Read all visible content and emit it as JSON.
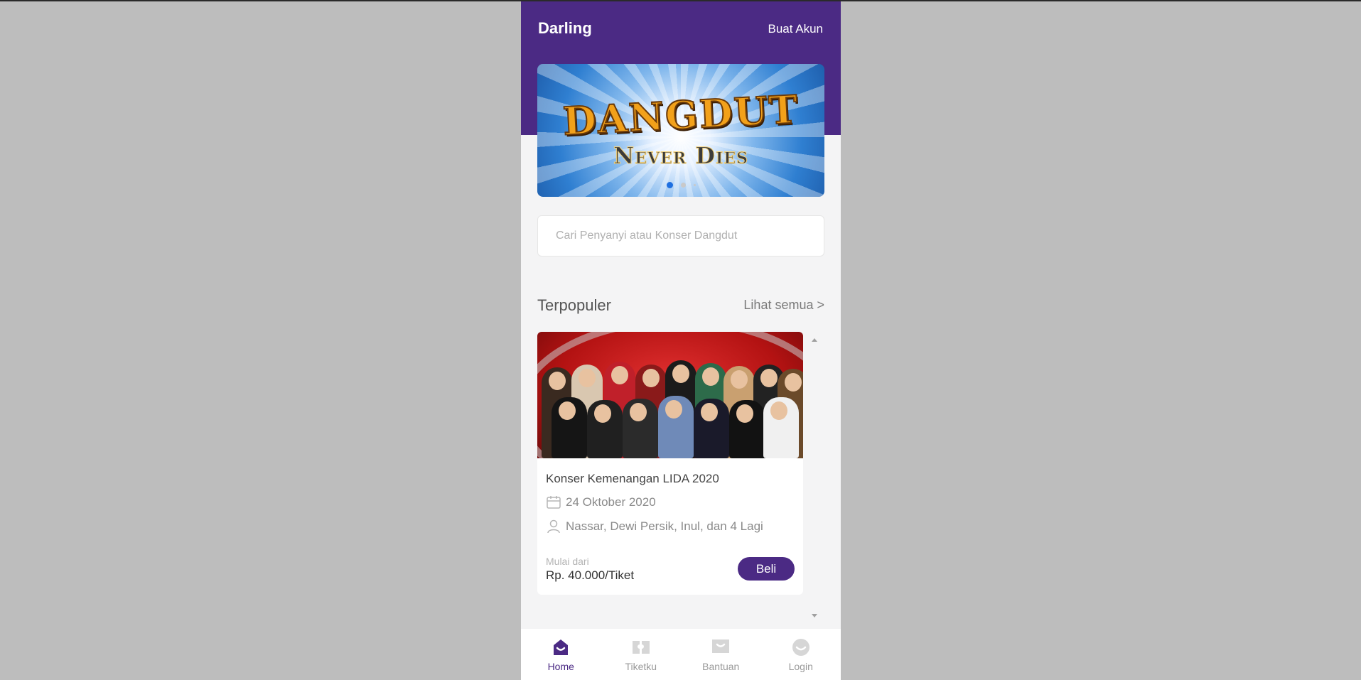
{
  "header": {
    "brand": "Darling",
    "create_account": "Buat Akun"
  },
  "banner": {
    "title": "DANGDUT",
    "subtitle": "Never Dies",
    "slides": 3,
    "active_slide": 1
  },
  "search": {
    "placeholder": "Cari Penyanyi atau Konser Dangdut",
    "value": ""
  },
  "popular": {
    "title": "Terpopuler",
    "see_all": "Lihat semua >"
  },
  "concert_card": {
    "title": "Konser Kemenangan LIDA 2020",
    "date": "24 Oktober 2020",
    "performers": "Nassar, Dewi Persik, Inul, dan 4 Lagi",
    "price_label": "Mulai dari",
    "price": "Rp. 40.000/Tiket",
    "buy_label": "Beli"
  },
  "nav": {
    "items": [
      {
        "label": "Home",
        "icon": "home-icon",
        "active": true
      },
      {
        "label": "Tiketku",
        "icon": "ticket-icon",
        "active": false
      },
      {
        "label": "Bantuan",
        "icon": "help-chat-icon",
        "active": false
      },
      {
        "label": "Login",
        "icon": "login-smile-icon",
        "active": false
      }
    ]
  },
  "colors": {
    "primary": "#4b2a84",
    "page_background": "#bdbdbd",
    "app_background": "#f4f4f5",
    "active_dot": "#1e6fe0"
  }
}
